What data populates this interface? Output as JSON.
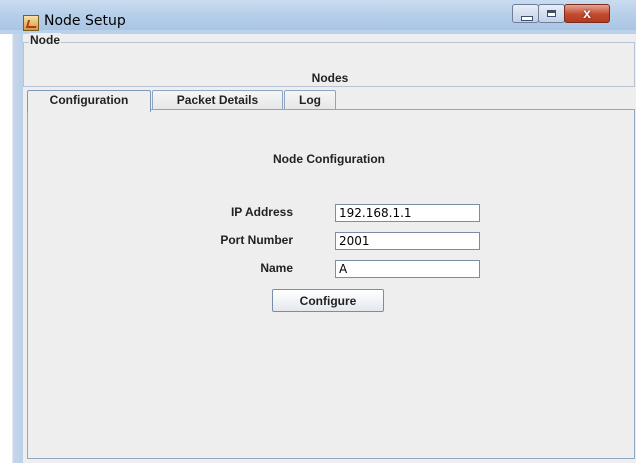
{
  "window": {
    "title": "Node Setup",
    "controls": {
      "minimize": "minimize-icon",
      "maximize": "maximize-icon",
      "close": "close-icon",
      "close_glyph": "x"
    }
  },
  "node_panel": {
    "legend": "Node",
    "label": "Nodes"
  },
  "tabs": [
    {
      "label": "Configuration",
      "active": true
    },
    {
      "label": "Packet Details",
      "active": false
    },
    {
      "label": "Log",
      "active": false
    }
  ],
  "config": {
    "title": "Node Configuration",
    "fields": [
      {
        "label": "IP Address",
        "value": "192.168.1.1"
      },
      {
        "label": "Port Number",
        "value": "2001"
      },
      {
        "label": "Name",
        "value": "A"
      }
    ],
    "button_label": "Configure"
  },
  "colors": {
    "titlebar": "#b9d1ea",
    "panel_bg": "#eeeeee",
    "close_button": "#c24a2e"
  }
}
